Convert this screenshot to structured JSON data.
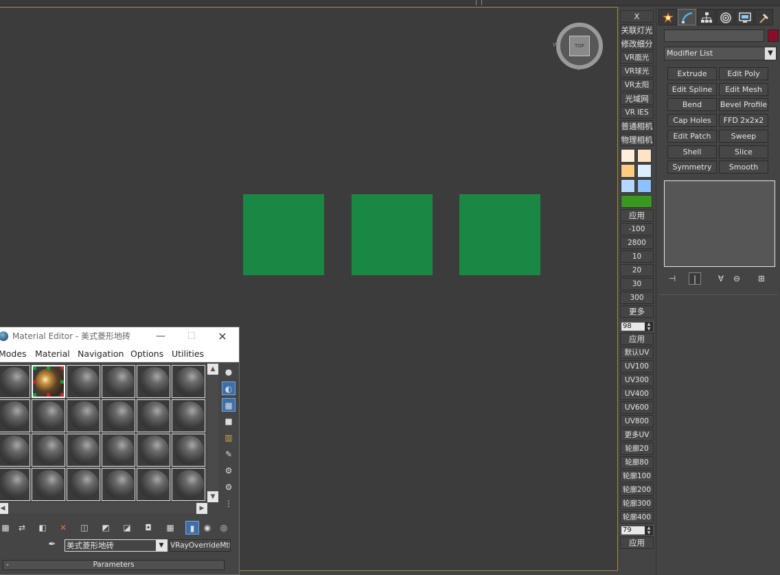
{
  "viewport": {
    "viewcube_label": "TOP",
    "viewcube_letters": [
      "W",
      "S"
    ]
  },
  "mid_toolbar": {
    "buttons": [
      "X",
      "关联灯光",
      "修改细分",
      "VR面光",
      "VR球光",
      "VR太阳",
      "光域网",
      "VR IES",
      "普通相机",
      "物理相机"
    ],
    "swatch_colors": [
      "#fdefdc",
      "#fde4c4",
      "#fdcc80",
      "#ddefff",
      "#b4d8ff",
      "#8cc1ff"
    ],
    "wide_swatch_color": "#3a9820",
    "apply_1": "应用",
    "values": [
      "-100",
      "2800",
      "10",
      "20",
      "30",
      "300"
    ],
    "more": "更多",
    "spinner_1": "98",
    "apply_2": "应用",
    "uv_buttons": [
      "默认UV",
      "UV100",
      "UV300",
      "UV400",
      "UV600",
      "UV800",
      "更多UV"
    ],
    "contour_buttons": [
      "轮廓20",
      "轮廓80",
      "轮廓100",
      "轮廓200",
      "轮廓300",
      "轮廓400"
    ],
    "spinner_2": "79",
    "apply_3": "应用"
  },
  "command_panel": {
    "object_color": "#8a0e2c",
    "modifier_list": "Modifier List",
    "modifiers": [
      "Extrude",
      "Edit Poly",
      "Edit Spline",
      "Edit Mesh",
      "Bend",
      "Bevel Profile",
      "Cap Holes",
      "FFD 2x2x2",
      "Edit Patch",
      "Sweep",
      "Shell",
      "Slice",
      "Symmetry",
      "Smooth"
    ]
  },
  "material_editor": {
    "title": "Material Editor - 美式菱形地砖",
    "menu": [
      "Modes",
      "Material",
      "Navigation",
      "Options",
      "Utilities"
    ],
    "material_name": "美式菱形地砖",
    "material_type": "VRayOverrideMtl",
    "parameters_label": "Parameters",
    "collapse_symbol": "-"
  },
  "colors": {
    "viewport_bg": "#3c3c3c",
    "object_green": "#1b8744",
    "viewport_border": "#a68c3a",
    "accent_blue": "#3d6ea8"
  }
}
